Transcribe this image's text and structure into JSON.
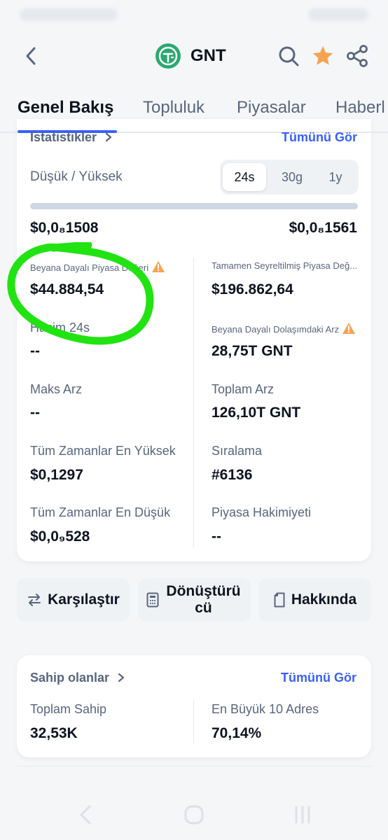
{
  "header": {
    "title": "GNT",
    "icons": [
      "back-arrow-icon",
      "coin-logo-icon",
      "search-icon",
      "star-icon",
      "share-icon"
    ],
    "colors": {
      "star": "#f6a351",
      "accent": "#3861fb",
      "highlight": "#22e312"
    }
  },
  "tabs": [
    "Genel Bakış",
    "Topluluk",
    "Piyasalar",
    "Haberl"
  ],
  "stats": {
    "section_title": "İstatistikler",
    "see_all": "Tümünü Gör",
    "range_label": "Düşük / Yüksek",
    "periods": [
      "24s",
      "30g",
      "1y"
    ],
    "selected_period": "24s",
    "low": "$0,0₈1508",
    "high": "$0,0₈1561",
    "left": [
      {
        "label": "Beyana Dayalı Piyasa Değeri",
        "value": "$44.884,54"
      },
      {
        "label": "Hacim 24s",
        "value": "--"
      },
      {
        "label": "Maks Arz",
        "value": "--"
      },
      {
        "label": "Tüm Zamanlar En Yüksek",
        "value": "$0,1297"
      },
      {
        "label": "Tüm Zamanlar En Düşük",
        "value": "$0,0₉528"
      }
    ],
    "right": [
      {
        "label": "Tamamen Seyreltilmiş Piyasa Değ...",
        "value": "$196.862,64"
      },
      {
        "label": "Beyana Dayalı Dolaşımdaki Arz",
        "value": "28,75T GNT"
      },
      {
        "label": "Toplam Arz",
        "value": "126,10T GNT"
      },
      {
        "label": "Sıralama",
        "value": "#6136"
      },
      {
        "label": "Piyasa Hakimiyeti",
        "value": "--"
      }
    ]
  },
  "actions": {
    "compare": "Karşılaştır",
    "converter": "Dönüştürücü",
    "about": "Hakkında"
  },
  "holders": {
    "title": "Sahip olanlar",
    "see_all": "Tümünü Gör",
    "total_label": "Toplam Sahip",
    "total_value": "32,53K",
    "top10_label": "En Büyük 10 Adres",
    "top10_value": "70,14%"
  }
}
